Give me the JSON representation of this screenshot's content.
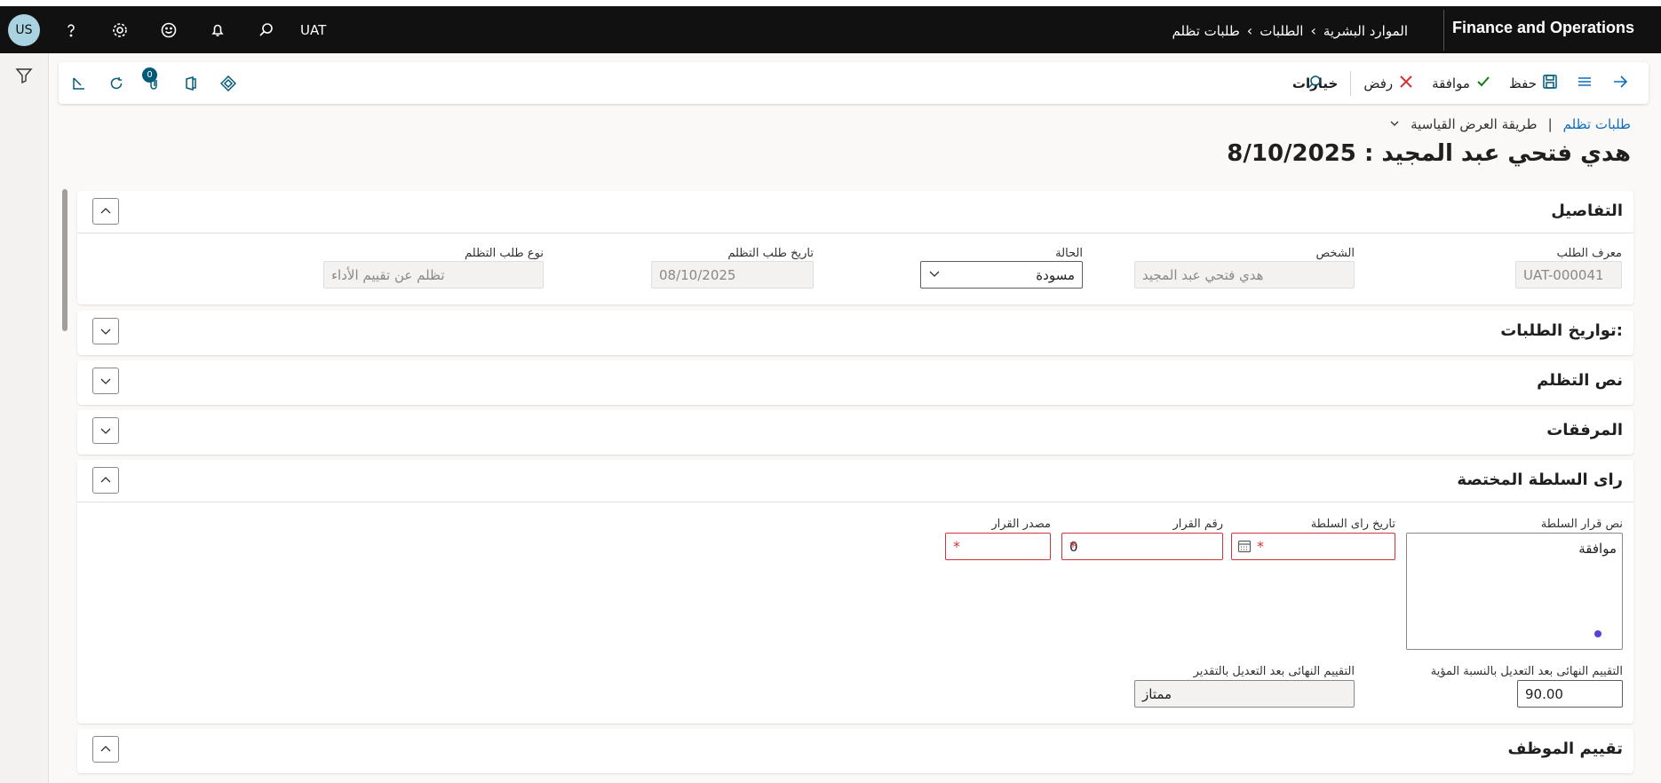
{
  "topbar": {
    "app_name": "Finance and Operations",
    "environment": "UAT",
    "avatar_initials": "US",
    "breadcrumb": [
      "الموارد البشرية",
      "الطلبات",
      "طلبات تظلم"
    ]
  },
  "actionbar": {
    "save": "حفظ",
    "approve": "موافقة",
    "reject": "رفض",
    "options": "خيارات",
    "attachments_count": "0"
  },
  "page": {
    "breadcrumb_link": "طلبات تظلم",
    "separator": "|",
    "view": "طريقة العرض القياسية",
    "title": "هدي فتحي عبد المجيد : 8/10/2025"
  },
  "details": {
    "title": "التفاصيل",
    "request_id_label": "معرف الطلب",
    "request_id_value": "UAT-000041",
    "person_label": "الشخص",
    "person_value": "هدي فتحي عبد المجيد",
    "status_label": "الحالة",
    "status_value": "مسودة",
    "date_label": "تاريخ طلب التظلم",
    "date_value": "08/10/2025",
    "type_label": "نوع طلب التظلم",
    "type_value": "تظلم عن تقييم الأداء"
  },
  "sections": {
    "request_dates": "تواريخ الطلبات:",
    "grievance_text": "نص التظلم",
    "attachments": "المرفقات",
    "authority_opinion": "راى السلطة المختصة",
    "employee_evaluation": "تقييم الموظف"
  },
  "authority": {
    "decision_text_label": "نص قرار السلطة",
    "decision_text_value": "موافقة",
    "opinion_date_label": "تاريخ راى السلطة",
    "opinion_date_value": "",
    "decision_number_label": "رقم القرار",
    "decision_number_value": "0",
    "decision_source_label": "مصدر القرار",
    "decision_source_value": "",
    "final_percent_label": "التقييم النهائى بعد التعديل بالنسبة المؤية",
    "final_percent_value": "90.00",
    "final_grade_label": "التقييم النهائى بعد التعديل بالتقدير",
    "final_grade_value": "ممتاز"
  },
  "colors": {
    "topbar": "#111111",
    "accent": "#0f6cbd",
    "required": "#d13438",
    "teal": "#005a78"
  }
}
